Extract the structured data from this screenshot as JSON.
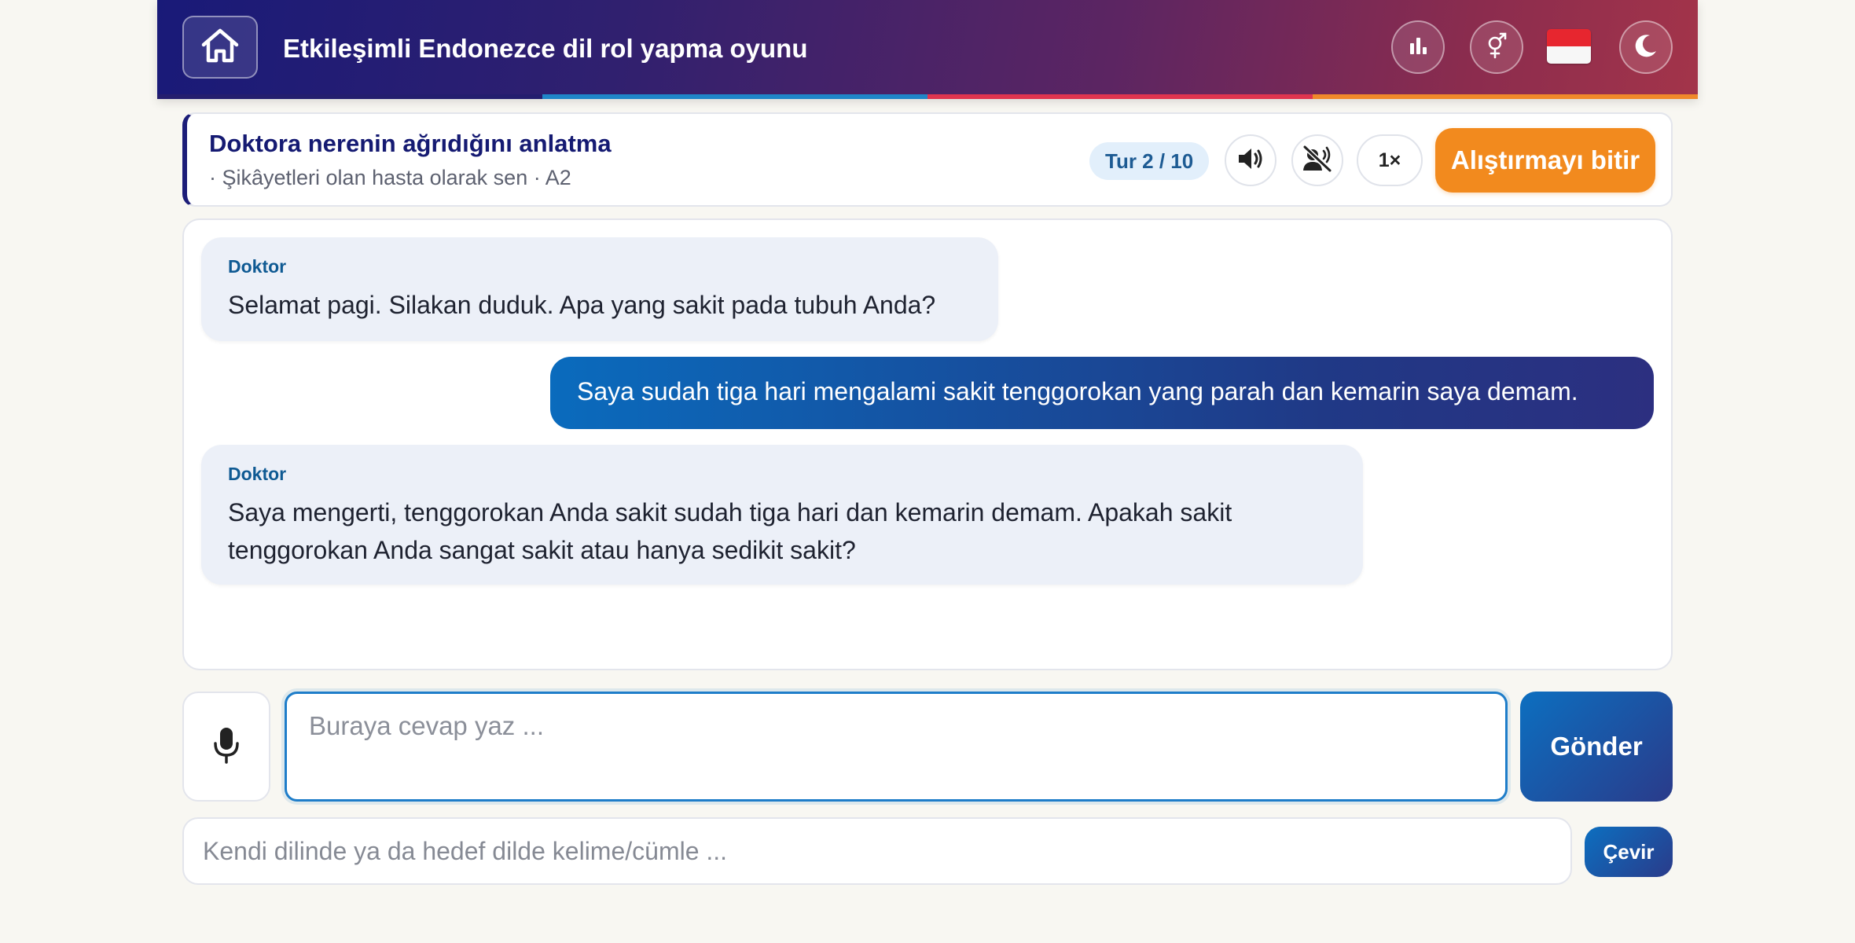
{
  "header": {
    "title": "Etkileşimli Endonezce dil rol yapma oyunu",
    "icons": [
      "home-icon",
      "stats-icon",
      "gender-icon",
      "flag-indonesia",
      "moon-icon"
    ],
    "gradient": [
      "#191a78",
      "#5c2562",
      "#a3344a"
    ],
    "stripe_colors": [
      "#241e6e",
      "#1f86c8",
      "#e0354f",
      "#f0892a"
    ]
  },
  "scenario": {
    "title": "Doktora nerenin ağrıdığını anlatma",
    "subtitle": "· Şikâyetleri olan hasta olarak sen · A2",
    "turn": "Tur 2 / 10",
    "speed": "1×",
    "finish_label": "Alıştırmayı bitir",
    "accent": "#f28a1e"
  },
  "chat": {
    "messages": [
      {
        "role": "bot",
        "speaker": "Doktor",
        "text": "Selamat pagi. Silakan duduk. Apa yang sakit pada tubuh Anda?"
      },
      {
        "role": "user",
        "text": "Saya sudah tiga hari mengalami sakit tenggorokan yang parah dan kemarin saya demam."
      },
      {
        "role": "bot",
        "speaker": "Doktor",
        "text": "Saya mengerti, tenggorokan Anda sakit sudah tiga hari dan kemarin demam. Apakah sakit tenggorokan Anda sangat sakit atau hanya sedikit sakit?"
      }
    ]
  },
  "input": {
    "answer_placeholder": "Buraya cevap yaz ...",
    "answer_value": "",
    "send_label": "Gönder",
    "translate_placeholder": "Kendi dilinde ya da hedef dilde kelime/cümle ...",
    "translate_value": "",
    "translate_label": "Çevir"
  }
}
